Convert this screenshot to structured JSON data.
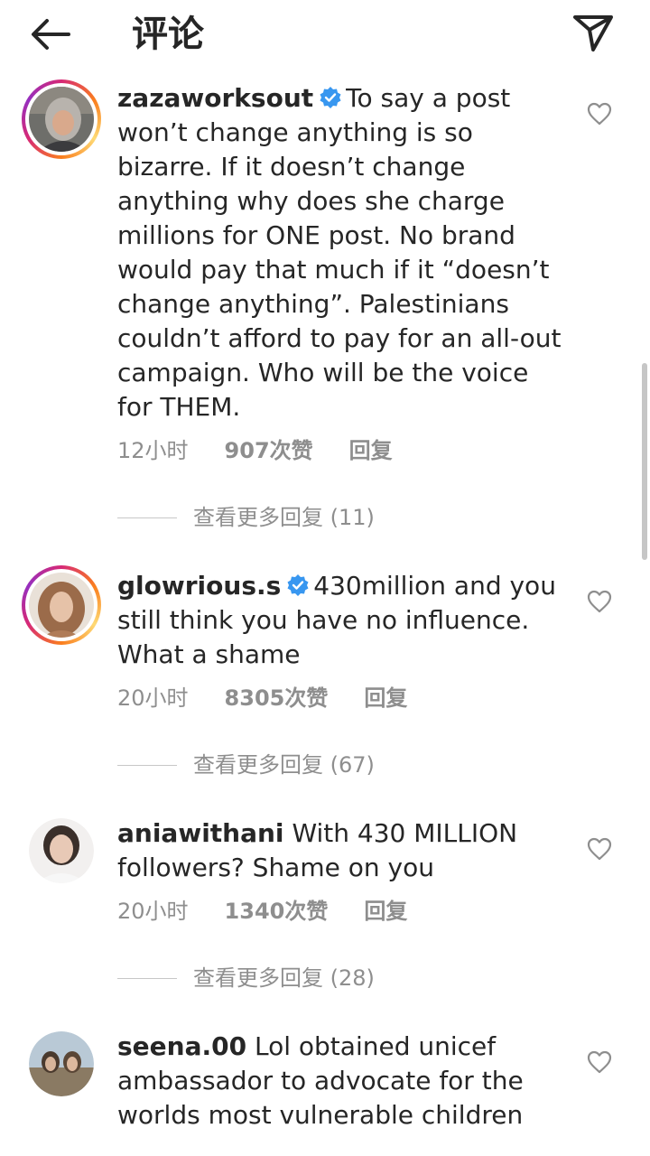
{
  "header": {
    "title": "评论"
  },
  "comments": [
    {
      "username": "zazaworksout",
      "verified": true,
      "text": "To say a post won’t change anything is so bizarre. If it doesn’t change anything why does she charge millions for ONE post. No brand would pay that much if it “doesn’t change anything”. Palestinians couldn’t afford to pay for an all-out campaign. Who will be the voice for THEM.",
      "time": "12小时",
      "likes": "907次赞",
      "reply": "回复",
      "view_replies": "查看更多回复 (11)"
    },
    {
      "username": "glowrious.s",
      "verified": true,
      "text": "430million and you still think you have no influence. What a shame",
      "time": "20小时",
      "likes": "8305次赞",
      "reply": "回复",
      "view_replies": "查看更多回复 (67)"
    },
    {
      "username": "aniawithani",
      "verified": false,
      "text": "With 430 MILLION followers? Shame on you",
      "time": "20小时",
      "likes": "1340次赞",
      "reply": "回复",
      "view_replies": "查看更多回复 (28)"
    },
    {
      "username": "seena.00",
      "verified": false,
      "text": "Lol obtained unicef ambassador to advocate for the worlds most vulnerable children"
    }
  ],
  "icons": {
    "back": "arrow-left-icon",
    "share": "paper-plane-icon",
    "like": "heart-outline-icon",
    "verified": "verified-badge-icon"
  },
  "colors": {
    "verified": "#3897f0",
    "meta": "#8e8e8e",
    "text": "#262626"
  }
}
